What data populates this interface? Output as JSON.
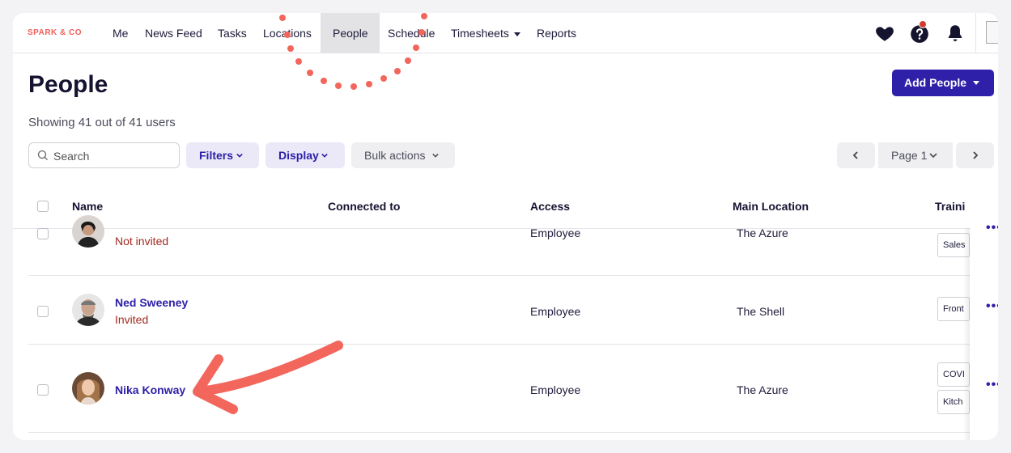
{
  "brand": {
    "logo_text": "SPARK & CO",
    "accent": "#f0605a",
    "primary": "#2e20a8"
  },
  "nav": {
    "items": [
      {
        "label": "Me"
      },
      {
        "label": "News Feed"
      },
      {
        "label": "Tasks"
      },
      {
        "label": "Locations"
      },
      {
        "label": "People",
        "active": true
      },
      {
        "label": "Schedule"
      },
      {
        "label": "Timesheets",
        "has_dropdown": true
      },
      {
        "label": "Reports"
      }
    ],
    "icons": [
      "heart-icon",
      "help-icon",
      "bell-icon"
    ]
  },
  "header": {
    "title": "People",
    "add_button_label": "Add People",
    "showing_text": "Showing 41 out of 41 users"
  },
  "toolbar": {
    "search_placeholder": "Search",
    "filters_label": "Filters",
    "display_label": "Display",
    "bulk_actions_label": "Bulk actions",
    "page_label": "Page 1"
  },
  "table": {
    "columns": [
      "Name",
      "Connected to",
      "Access",
      "Main Location",
      "Traini"
    ],
    "rows": [
      {
        "name": "",
        "status": "Not invited",
        "access": "Employee",
        "location": "The Azure",
        "tags": [
          "Sales"
        ]
      },
      {
        "name": "Ned Sweeney",
        "status": "Invited",
        "access": "Employee",
        "location": "The Shell",
        "tags": [
          "Front"
        ]
      },
      {
        "name": "Nika Konway",
        "status": "",
        "access": "Employee",
        "location": "The Azure",
        "tags": [
          "COVI",
          "Kitch"
        ]
      }
    ],
    "row_action": "•••"
  }
}
